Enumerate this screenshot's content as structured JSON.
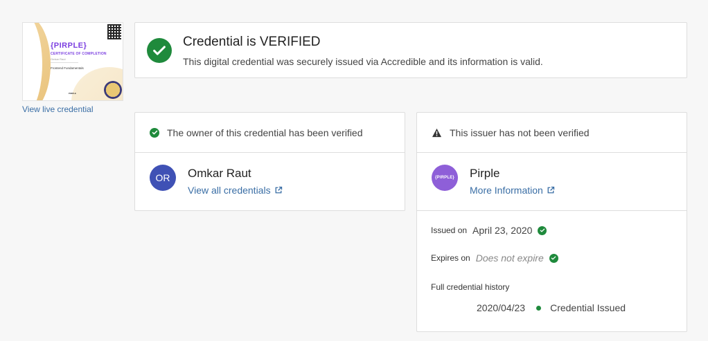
{
  "thumbnail": {
    "brand": "{PIRPLE}",
    "subtitle": "CERTIFICATE OF COMPLETION",
    "recipient": "Omkar Raut",
    "course": "Frontend Fundamentals",
    "signature": "PIRPLE",
    "view_live_label": "View live credential"
  },
  "verification": {
    "title": "Credential is VERIFIED",
    "description": "This digital credential was securely issued via Accredible and its information is valid."
  },
  "owner": {
    "header": "The owner of this credential has been verified",
    "initials": "OR",
    "name": "Omkar Raut",
    "link_label": "View all credentials"
  },
  "issuer": {
    "header": "This issuer has not been verified",
    "avatar_text": "{PIRPLE}",
    "name": "Pirple",
    "link_label": "More Information",
    "issued_label": "Issued on",
    "issued_value": "April 23, 2020",
    "expires_label": "Expires on",
    "expires_value": "Does not expire",
    "history_title": "Full credential history",
    "history": [
      {
        "date": "2020/04/23",
        "event": "Credential Issued"
      }
    ]
  },
  "colors": {
    "success": "#1f8a3c",
    "link": "#3a6ea5",
    "owner_avatar": "#3f51b5",
    "issuer_avatar": "#8e5fd8"
  }
}
